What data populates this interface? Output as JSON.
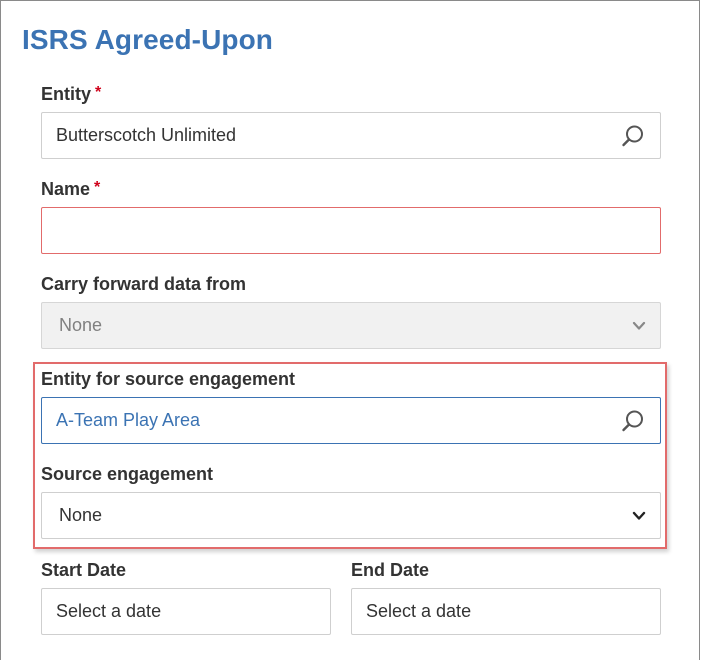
{
  "title": "ISRS Agreed-Upon",
  "entity": {
    "label": "Entity",
    "required_mark": "*",
    "value": "Butterscotch Unlimited",
    "icon": "search-icon"
  },
  "name": {
    "label": "Name",
    "required_mark": "*",
    "value": ""
  },
  "carry_forward": {
    "label": "Carry forward data from",
    "selected": "None",
    "disabled": true
  },
  "source_entity": {
    "label": "Entity for source engagement",
    "value": "A-Team Play Area",
    "icon": "search-icon"
  },
  "source_engagement": {
    "label": "Source engagement",
    "selected": "None"
  },
  "start_date": {
    "label": "Start Date",
    "placeholder": "Select a date"
  },
  "end_date": {
    "label": "End Date",
    "placeholder": "Select a date"
  },
  "colors": {
    "title": "#3b73b3",
    "required": "#d0021b",
    "error_border": "#e26b6b",
    "focus_border": "#3b73b3",
    "disabled_bg": "#f1f1f1",
    "link_text": "#3b73b3"
  }
}
